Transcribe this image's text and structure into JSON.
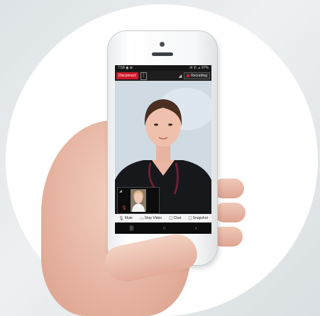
{
  "status_bar": {
    "time": "7:58",
    "status_icons": "◉ ⊕",
    "right_icons": "✉ ✆ ⊿",
    "battery": "97%"
  },
  "toolbar": {
    "disconnect_label": "Disconnect",
    "more_icon": "⋮",
    "signal_icon": "◢",
    "recording_label": "Recording"
  },
  "controls": {
    "mute_icon": "🎙",
    "mute_label": "Mute",
    "stop_video_icon": "▭",
    "stop_video_label": "Stop Video",
    "chat_icon": "☐",
    "chat_label": "Chat",
    "snapshot_icon": "☐",
    "snapshot_label": "Snapshot"
  },
  "pip": {
    "fullscreen_icon": "◢",
    "mic_icon": "🎙"
  },
  "navbar": {
    "recents_icon": "|||",
    "home_icon": "○",
    "back_icon": "‹"
  },
  "colors": {
    "disconnect_bg": "#d0182a",
    "recording_dot": "#e0202a"
  }
}
